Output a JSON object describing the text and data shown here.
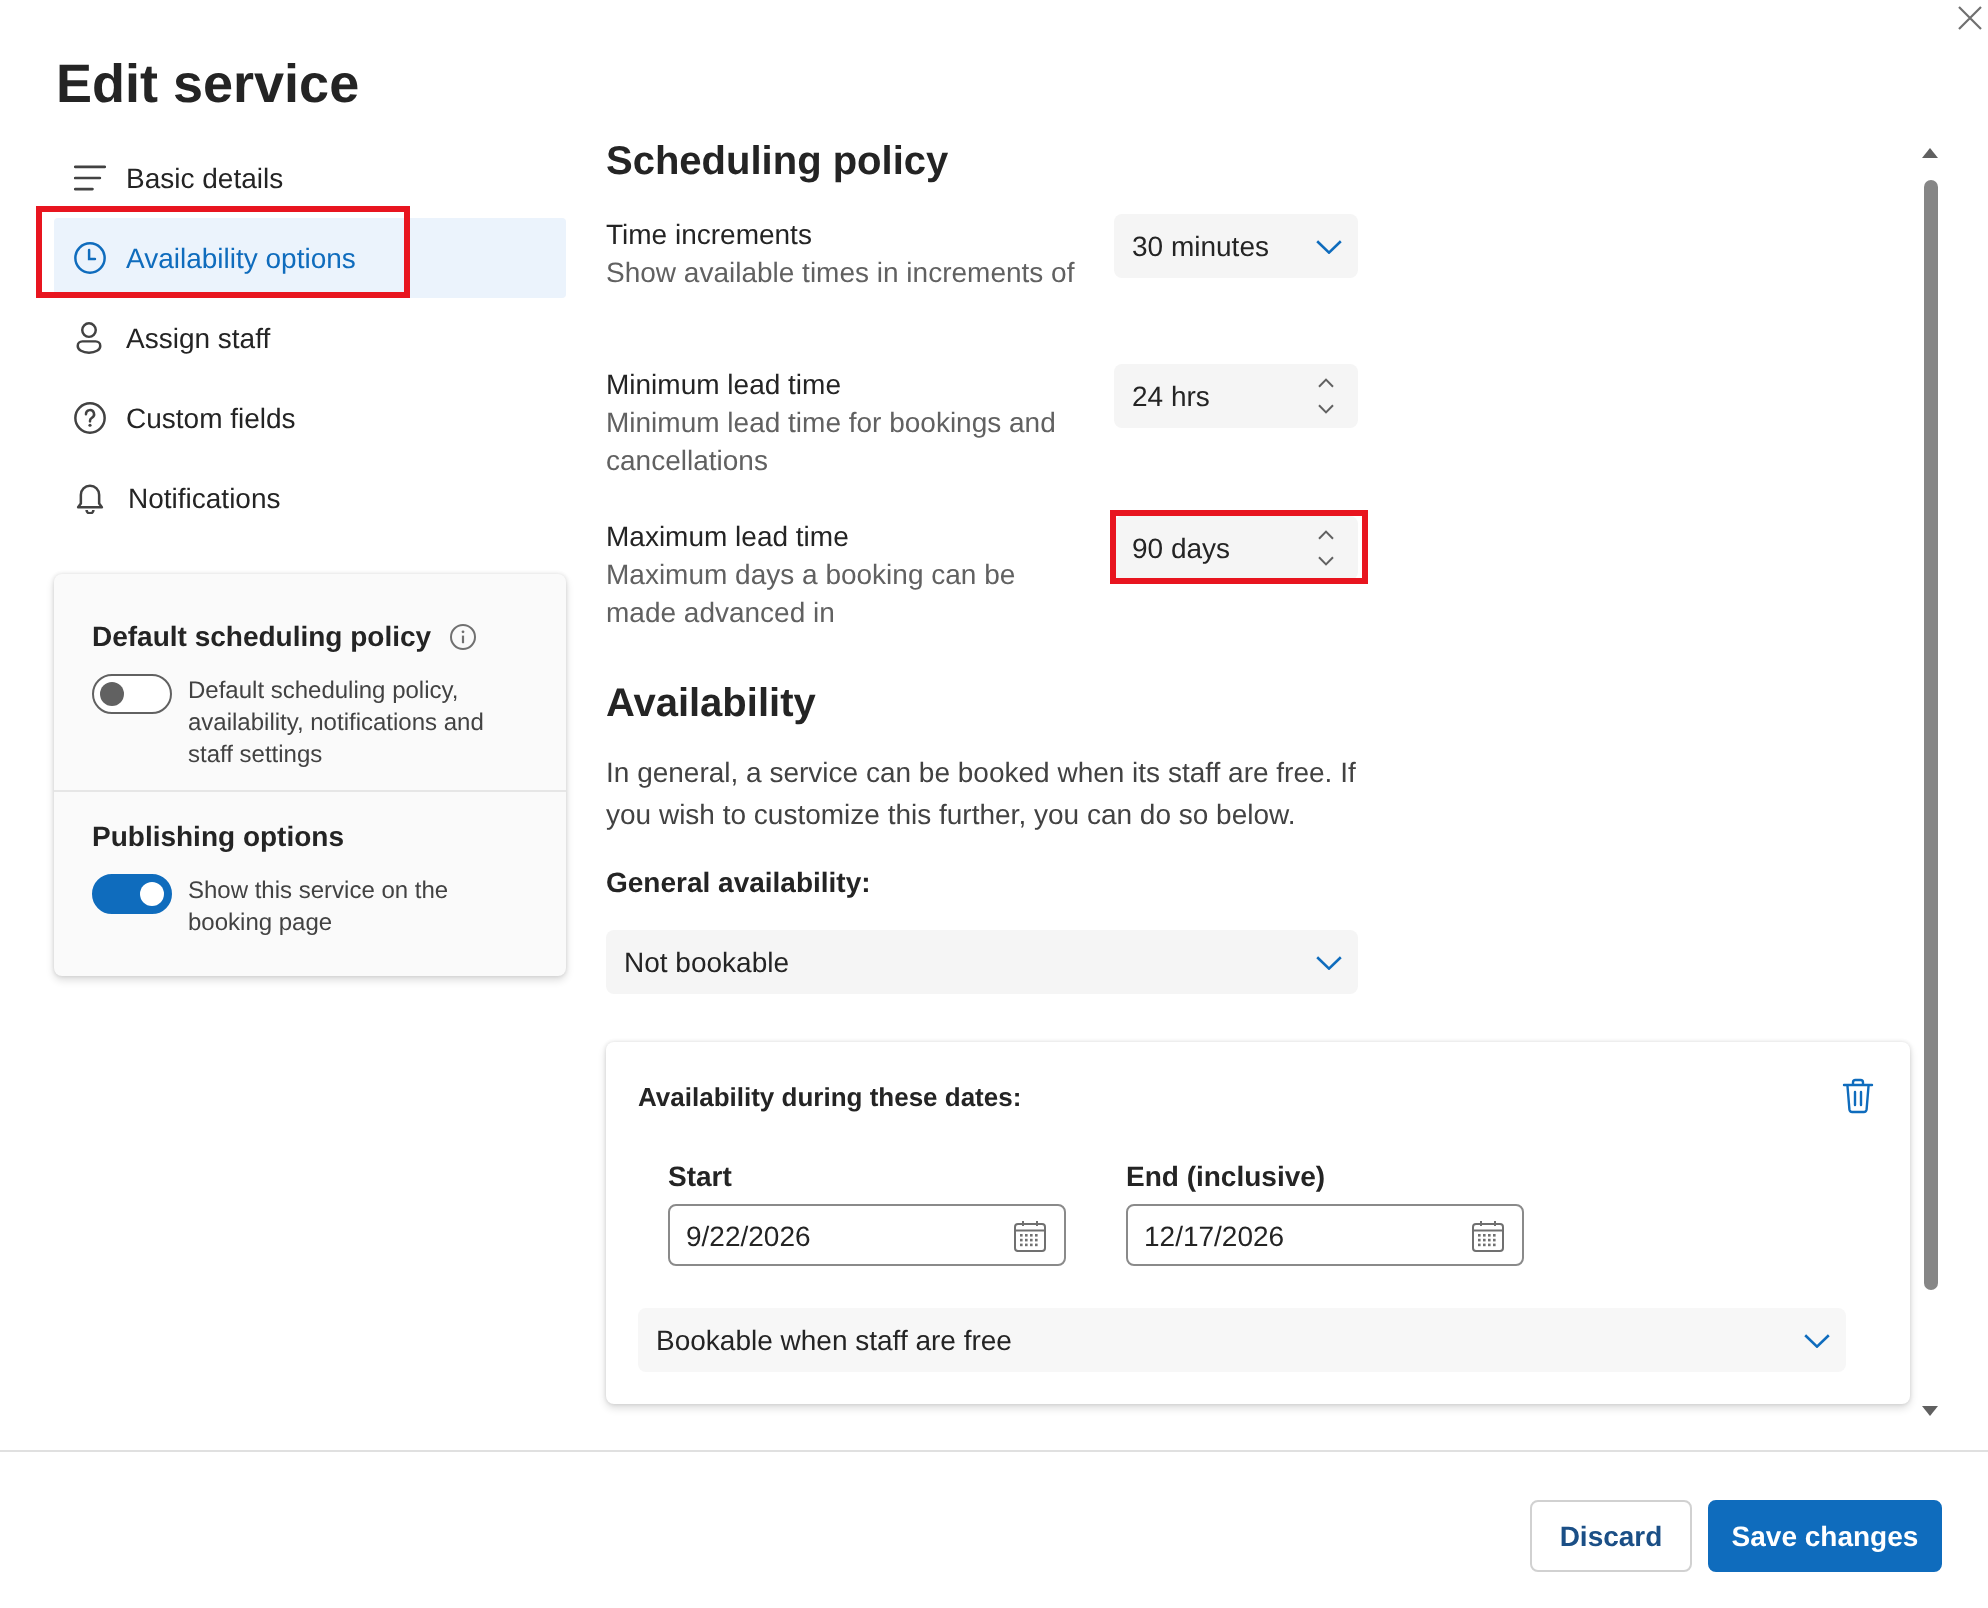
{
  "dialog": {
    "title": "Edit service"
  },
  "nav": {
    "items": [
      {
        "label": "Basic details",
        "selected": false,
        "highlighted": false
      },
      {
        "label": "Availability options",
        "selected": true,
        "highlighted": true
      },
      {
        "label": "Assign staff",
        "selected": false,
        "highlighted": false
      },
      {
        "label": "Custom fields",
        "selected": false,
        "highlighted": false
      },
      {
        "label": "Notifications",
        "selected": false,
        "highlighted": false
      }
    ]
  },
  "side_card": {
    "sections": [
      {
        "title": "Default scheduling policy",
        "info": true,
        "on": false,
        "text": "Default scheduling policy, availability, notifications and staff settings"
      },
      {
        "title": "Publishing options",
        "info": false,
        "on": true,
        "text": "Show this service on the booking page"
      }
    ]
  },
  "scheduling_policy": {
    "heading": "Scheduling policy",
    "rows": [
      {
        "label": "Time increments",
        "description": "Show available times in increments of",
        "kind": "dropdown",
        "value": "30 minutes",
        "highlighted": false
      },
      {
        "label": "Minimum lead time",
        "description": "Minimum lead time for bookings and cancellations",
        "kind": "spinner",
        "value": "24 hrs",
        "highlighted": false
      },
      {
        "label": "Maximum lead time",
        "description": "Maximum days a booking can be made advanced in",
        "kind": "spinner",
        "value": "90 days",
        "highlighted": true
      }
    ]
  },
  "availability": {
    "heading": "Availability",
    "intro": "In general, a service can be booked when its staff are free. If you wish to customize this further, you can do so below.",
    "general_label": "General availability:",
    "general_value": "Not bookable",
    "date_range": {
      "title": "Availability during these dates:",
      "dates": [
        {
          "label": "Start",
          "value": "9/22/2026"
        },
        {
          "label": "End (inclusive)",
          "value": "12/17/2026"
        }
      ],
      "mode": "Bookable when staff are free"
    }
  },
  "footer": {
    "buttons": [
      {
        "label": "Discard",
        "kind": "secondary"
      },
      {
        "label": "Save changes",
        "kind": "primary"
      }
    ]
  }
}
